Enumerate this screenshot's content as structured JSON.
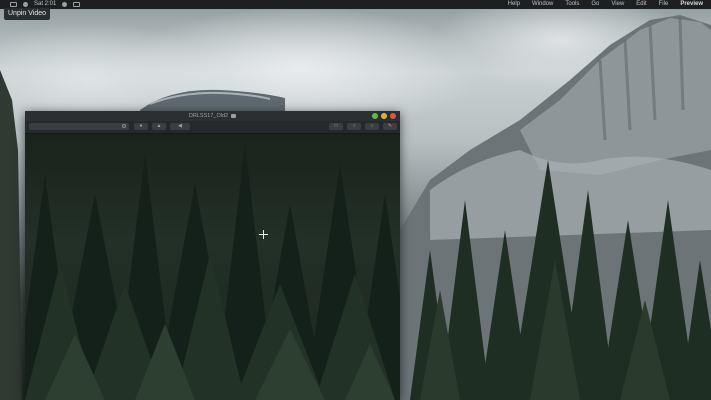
{
  "tooltip": {
    "text": "Unpin Video"
  },
  "menubar": {
    "left_items": [
      "Sat 2:01"
    ],
    "right_items": [
      "Help",
      "Window",
      "Tools",
      "Go",
      "View",
      "Edit",
      "File",
      "Preview"
    ]
  },
  "window": {
    "title": "DRLSS17_Old2",
    "search_placeholder": "",
    "toolbar_buttons": [
      {
        "name": "view-button",
        "icon": "eye-icon"
      },
      {
        "name": "share-button",
        "icon": "share-icon"
      },
      {
        "name": "tag-button",
        "icon": "tag-icon"
      },
      {
        "name": "action-button",
        "icon": "share-icon"
      },
      {
        "name": "zoom-in-button",
        "icon": "zoom-in-icon"
      },
      {
        "name": "zoom-out-button",
        "icon": "zoom-out-icon"
      },
      {
        "name": "markup-button",
        "icon": "markup-icon"
      }
    ]
  },
  "colors": {
    "menubar_bg": "#1d1f21",
    "window_chrome": "#2c2f31",
    "traffic_red": "#e2534a",
    "traffic_yellow": "#e0b23c",
    "traffic_green": "#5bbf3f"
  }
}
